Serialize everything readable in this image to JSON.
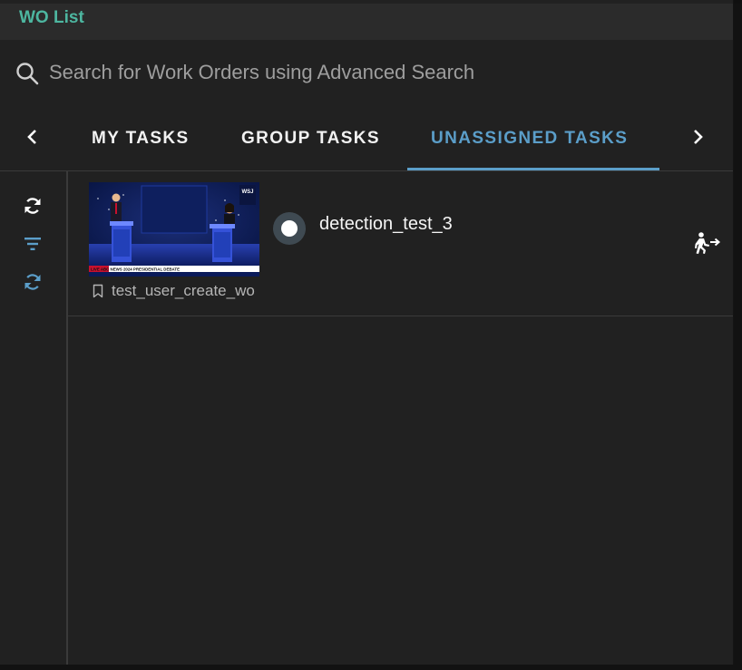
{
  "header": {
    "title": "WO List"
  },
  "search": {
    "placeholder": "Search for Work Orders using Advanced Search",
    "value": "",
    "icon": "search-icon"
  },
  "tabs": [
    {
      "label": "MY TASKS",
      "active": false
    },
    {
      "label": "GROUP TASKS",
      "active": false
    },
    {
      "label": "UNASSIGNED TASKS",
      "active": true
    }
  ],
  "sidebar": {
    "icons": [
      "refresh-icon",
      "filter-icon",
      "sync-icon"
    ]
  },
  "work_orders": [
    {
      "name": "detection_test_3",
      "creator": "test_user_create_wo",
      "status": "open",
      "thumbnail": {
        "corner_logo": "WSJ",
        "ticker_text": "LIVE ABC NEWS 2024 PRESIDENTIAL DEBATE"
      }
    }
  ],
  "colors": {
    "accent_teal": "#4db6a0",
    "accent_blue": "#5b9ec9",
    "background": "#212121",
    "header_background": "#2b2b2b"
  }
}
